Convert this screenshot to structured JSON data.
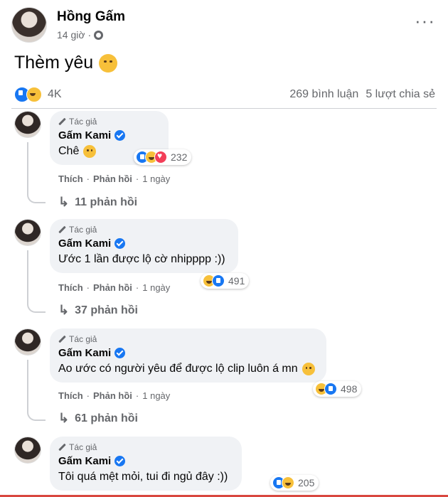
{
  "post": {
    "author": "Hồng Gấm",
    "time": "14 giờ",
    "text": "Thèm yêu",
    "reaction_count": "4K",
    "comment_count": "269 bình luận",
    "share_count": "5 lượt chia sẻ"
  },
  "labels": {
    "author_badge": "Tác giả",
    "like_action": "Thích",
    "reply_action": "Phản hồi",
    "separator": "·"
  },
  "comments": [
    {
      "name": "Gấm Kami",
      "text": "Chê",
      "reactions": "232",
      "time": "1 ngày",
      "replies": "11 phản hồi"
    },
    {
      "name": "Gấm Kami",
      "text": "Ước 1 lần được lộ cờ nhipppp :))",
      "reactions": "491",
      "time": "1 ngày",
      "replies": "37 phản hồi"
    },
    {
      "name": "Gấm Kami",
      "text": "Ao ước có người yêu để được lộ clip luôn á mn",
      "reactions": "498",
      "time": "1 ngày",
      "replies": "61 phản hồi"
    },
    {
      "name": "Gấm Kami",
      "text": "Tôi quá mệt mỏi, tui đi ngủ đây :))",
      "reactions": "205"
    }
  ],
  "icons": {
    "privacy": "globe-icon",
    "more": "more-options-icon",
    "badge": "pen-icon",
    "verified": "verified-icon",
    "reply": "reply-arrow-icon"
  },
  "colors": {
    "like": "#1877f2",
    "haha": "#f7c03a",
    "love": "#f33e58",
    "muted_text": "#65676b",
    "bubble": "#f0f2f5"
  }
}
